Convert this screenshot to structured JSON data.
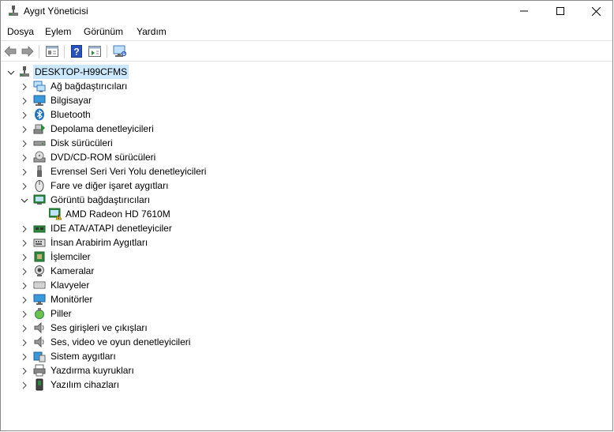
{
  "window": {
    "title": "Aygıt Yöneticisi"
  },
  "menu": {
    "items": [
      "Dosya",
      "Eylem",
      "Görünüm",
      "Yardım"
    ]
  },
  "tree": {
    "root": "DESKTOP-H99CFMS",
    "categories": [
      {
        "label": "Ağ bağdaştırıcıları",
        "icon": "network-adapter-icon"
      },
      {
        "label": "Bilgisayar",
        "icon": "computer-icon"
      },
      {
        "label": "Bluetooth",
        "icon": "bluetooth-icon"
      },
      {
        "label": "Depolama denetleyicileri",
        "icon": "storage-controller-icon"
      },
      {
        "label": "Disk sürücüleri",
        "icon": "disk-drive-icon"
      },
      {
        "label": "DVD/CD-ROM sürücüleri",
        "icon": "dvd-drive-icon"
      },
      {
        "label": "Evrensel Seri Veri Yolu denetleyicileri",
        "icon": "usb-icon"
      },
      {
        "label": "Fare ve diğer işaret aygıtları",
        "icon": "mouse-icon"
      },
      {
        "label": "Görüntü bağdaştırıcıları",
        "icon": "display-adapter-icon",
        "expanded": true,
        "children": [
          {
            "label": "AMD Radeon HD 7610M",
            "icon": "warning-icon"
          }
        ]
      },
      {
        "label": "IDE ATA/ATAPI denetleyiciler",
        "icon": "ide-controller-icon"
      },
      {
        "label": "İnsan Arabirim Aygıtları",
        "icon": "hid-icon"
      },
      {
        "label": "İşlemciler",
        "icon": "processor-icon"
      },
      {
        "label": "Kameralar",
        "icon": "camera-icon"
      },
      {
        "label": "Klavyeler",
        "icon": "keyboard-icon"
      },
      {
        "label": "Monitörler",
        "icon": "monitor-icon"
      },
      {
        "label": "Piller",
        "icon": "battery-icon"
      },
      {
        "label": "Ses girişleri ve çıkışları",
        "icon": "audio-io-icon"
      },
      {
        "label": "Ses, video ve oyun denetleyicileri",
        "icon": "sound-controller-icon"
      },
      {
        "label": "Sistem aygıtları",
        "icon": "system-devices-icon"
      },
      {
        "label": "Yazdırma kuyrukları",
        "icon": "print-queue-icon"
      },
      {
        "label": "Yazılım cihazları",
        "icon": "software-device-icon"
      }
    ]
  },
  "colors": {
    "selection": "#cce8ff",
    "warning": "#f5c400",
    "accent": "#1e73be"
  }
}
